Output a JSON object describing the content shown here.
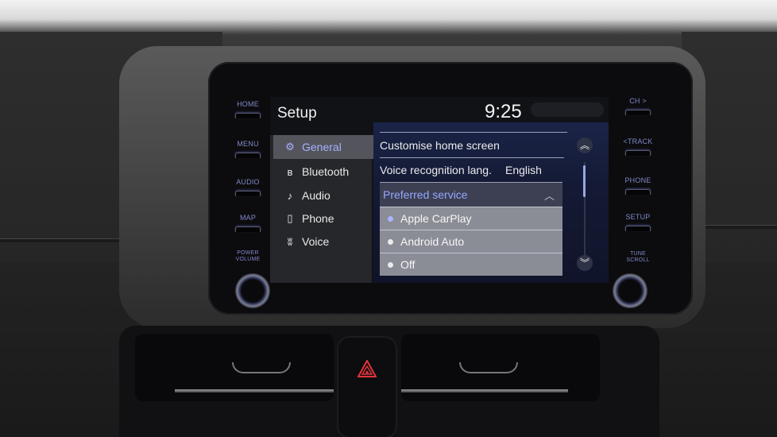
{
  "screen": {
    "title": "Setup",
    "clock": "9:25",
    "sidebar": {
      "items": [
        {
          "label": "General",
          "icon": "gear-icon",
          "glyph": "⚙",
          "active": true
        },
        {
          "label": "Bluetooth",
          "icon": "bluetooth-icon",
          "glyph": "ʙ",
          "active": false
        },
        {
          "label": "Audio",
          "icon": "music-note-icon",
          "glyph": "♪",
          "active": false
        },
        {
          "label": "Phone",
          "icon": "phone-icon",
          "glyph": "▯",
          "active": false
        },
        {
          "label": "Voice",
          "icon": "voice-icon",
          "glyph": "ʬ",
          "active": false
        }
      ],
      "more_glyph": "⌄"
    },
    "settings": {
      "customise_home": "Customise home screen",
      "voice_lang_label": "Voice recognition lang.",
      "voice_lang_value": "English",
      "preferred_service_label": "Preferred service",
      "preferred_chevron": "︿",
      "options": [
        {
          "label": "Apple CarPlay",
          "selected": true
        },
        {
          "label": "Android Auto",
          "selected": false
        },
        {
          "label": "Off",
          "selected": false
        }
      ],
      "scroll_up_glyph": "︽",
      "scroll_down_glyph": "︾"
    }
  },
  "hardware": {
    "left_buttons": [
      "HOME",
      "MENU",
      "AUDIO",
      "MAP"
    ],
    "left_knob_label_line1": "POWER",
    "left_knob_label_line2": "VOLUME",
    "right_buttons": [
      "CH >",
      "<TRACK",
      "PHONE",
      "SETUP"
    ],
    "right_knob_label_line1": "TUNE",
    "right_knob_label_line2": "SCROLL"
  },
  "colors": {
    "accent": "#a6b1ff",
    "hazard_red": "#e0343c"
  }
}
